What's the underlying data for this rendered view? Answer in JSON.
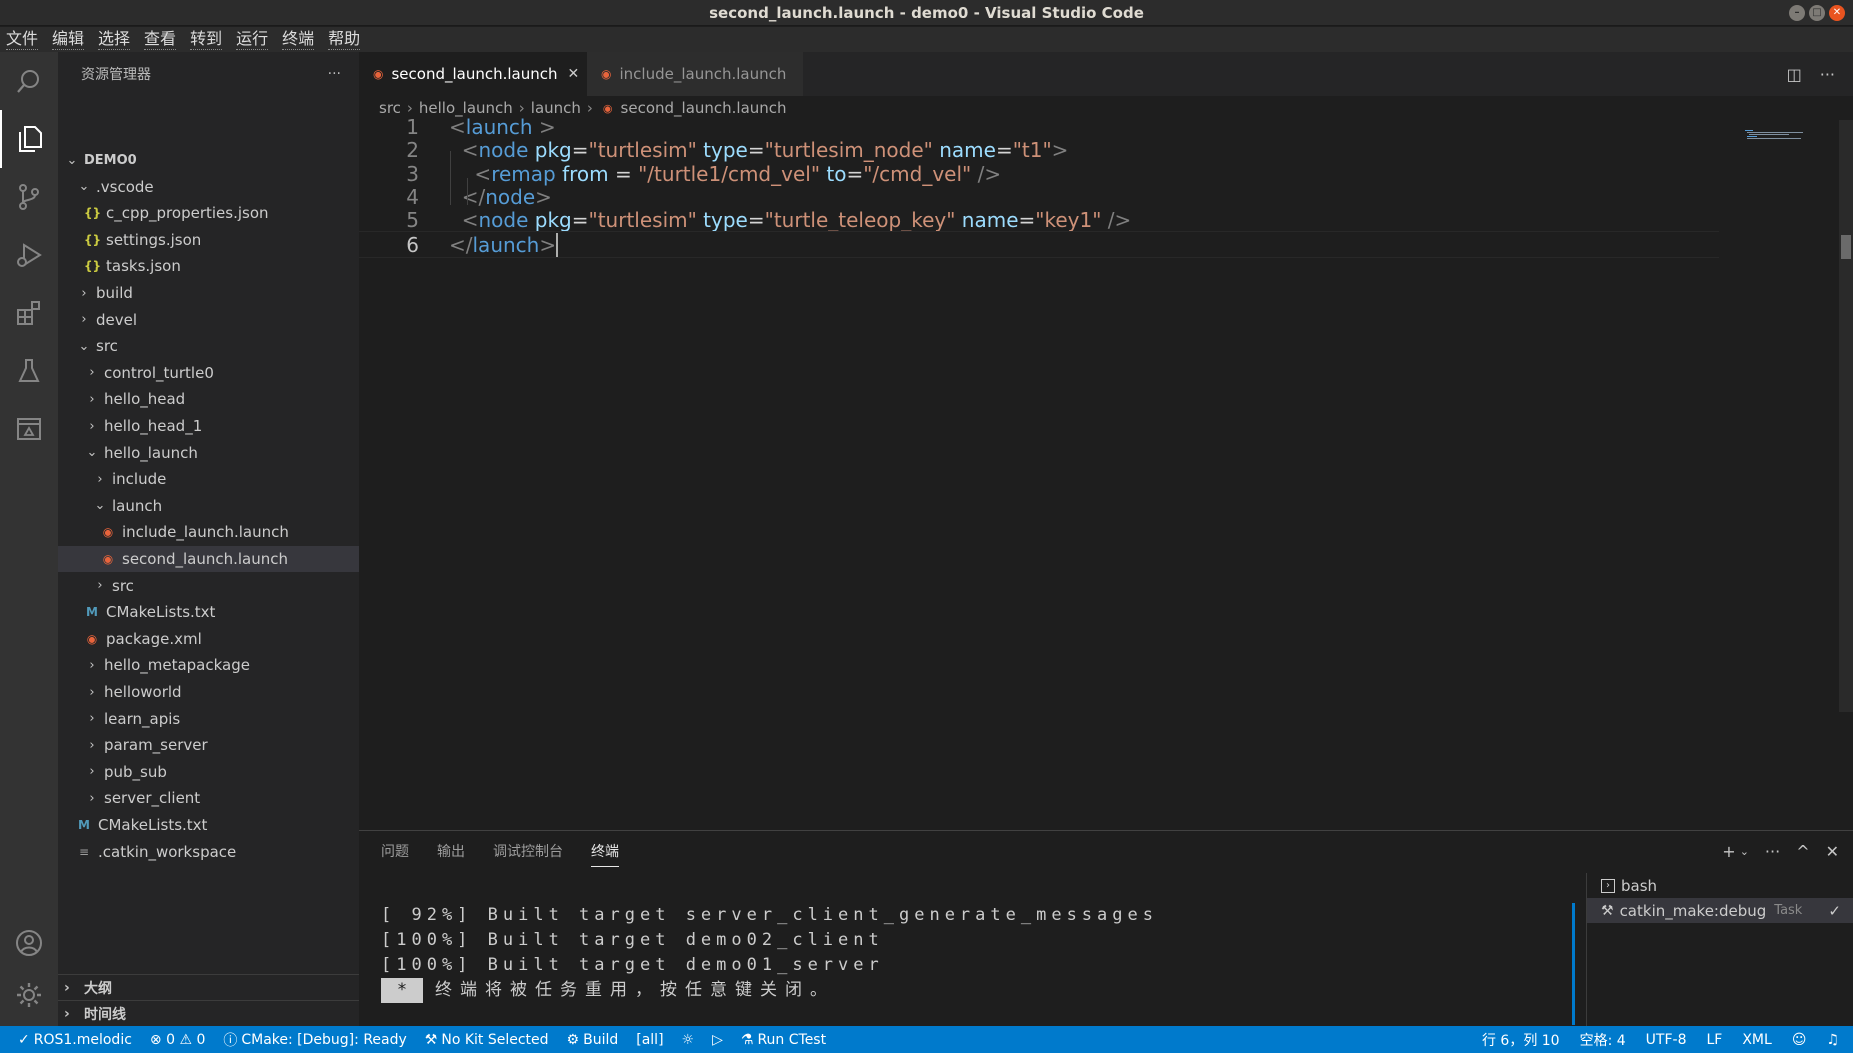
{
  "window": {
    "title": "second_launch.launch - demo0 - Visual Studio Code",
    "min": "–",
    "max": "□",
    "close": "✕"
  },
  "menu": [
    "文件",
    "编辑",
    "选择",
    "查看",
    "转到",
    "运行",
    "终端",
    "帮助"
  ],
  "sidebar": {
    "title": "资源管理器",
    "more": "···",
    "tree": [
      {
        "label": "DEMO0",
        "chev": "⌄",
        "icon": ""
      },
      {
        "label": ".vscode",
        "chev": "⌄",
        "icon": ""
      },
      {
        "label": "c_cpp_properties.json",
        "chev": "",
        "icon": "{}"
      },
      {
        "label": "settings.json",
        "chev": "",
        "icon": "{}"
      },
      {
        "label": "tasks.json",
        "chev": "",
        "icon": "{}"
      },
      {
        "label": "build",
        "chev": "›",
        "icon": ""
      },
      {
        "label": "devel",
        "chev": "›",
        "icon": ""
      },
      {
        "label": "src",
        "chev": "⌄",
        "icon": ""
      },
      {
        "label": "control_turtle0",
        "chev": "›",
        "icon": ""
      },
      {
        "label": "hello_head",
        "chev": "›",
        "icon": ""
      },
      {
        "label": "hello_head_1",
        "chev": "›",
        "icon": ""
      },
      {
        "label": "hello_launch",
        "chev": "⌄",
        "icon": ""
      },
      {
        "label": "include",
        "chev": "›",
        "icon": ""
      },
      {
        "label": "launch",
        "chev": "⌄",
        "icon": ""
      },
      {
        "label": "include_launch.launch",
        "chev": "",
        "icon": "rss"
      },
      {
        "label": "second_launch.launch",
        "chev": "",
        "icon": "rss"
      },
      {
        "label": "src",
        "chev": "›",
        "icon": ""
      },
      {
        "label": "CMakeLists.txt",
        "chev": "",
        "icon": "M"
      },
      {
        "label": "package.xml",
        "chev": "",
        "icon": "rss"
      },
      {
        "label": "hello_metapackage",
        "chev": "›",
        "icon": ""
      },
      {
        "label": "helloworld",
        "chev": "›",
        "icon": ""
      },
      {
        "label": "learn_apis",
        "chev": "›",
        "icon": ""
      },
      {
        "label": "param_server",
        "chev": "›",
        "icon": ""
      },
      {
        "label": "pub_sub",
        "chev": "›",
        "icon": ""
      },
      {
        "label": "server_client",
        "chev": "›",
        "icon": ""
      },
      {
        "label": "CMakeLists.txt",
        "chev": "",
        "icon": "M"
      },
      {
        "label": ".catkin_workspace",
        "chev": "",
        "icon": "≡"
      }
    ],
    "outline": "大纲",
    "timeline": "时间线",
    "collapsed": "›"
  },
  "tabs": [
    {
      "label": "second_launch.launch",
      "close": "✕"
    },
    {
      "label": "include_launch.launch"
    }
  ],
  "breadcrumb": [
    "src",
    "hello_launch",
    "launch",
    "second_launch.launch"
  ],
  "editor": {
    "lines": [
      {
        "n": "1",
        "parts": [
          [
            "t-br",
            "<"
          ],
          [
            "t-tag",
            "launch"
          ],
          [
            "t-br",
            " >"
          ]
        ]
      },
      {
        "n": "2",
        "parts": [
          [
            "t-br",
            "  <"
          ],
          [
            "t-tag",
            "node"
          ],
          [
            "t-attr",
            " pkg"
          ],
          [
            "t-eq",
            "="
          ],
          [
            "t-str",
            "\"turtlesim\""
          ],
          [
            "t-attr",
            " type"
          ],
          [
            "t-eq",
            "="
          ],
          [
            "t-str",
            "\"turtlesim_node\""
          ],
          [
            "t-attr",
            " name"
          ],
          [
            "t-eq",
            "="
          ],
          [
            "t-str",
            "\"t1\""
          ],
          [
            "t-br",
            ">"
          ]
        ]
      },
      {
        "n": "3",
        "parts": [
          [
            "t-br",
            "    <"
          ],
          [
            "t-tag",
            "remap"
          ],
          [
            "t-attr",
            " from"
          ],
          [
            "t-eq",
            " = "
          ],
          [
            "t-str",
            "\"/turtle1/cmd_vel\""
          ],
          [
            "t-attr",
            " to"
          ],
          [
            "t-eq",
            "="
          ],
          [
            "t-str",
            "\"/cmd_vel\""
          ],
          [
            "t-br",
            " />"
          ]
        ]
      },
      {
        "n": "4",
        "parts": [
          [
            "t-br",
            "  </"
          ],
          [
            "t-tag",
            "node"
          ],
          [
            "t-br",
            ">"
          ]
        ]
      },
      {
        "n": "5",
        "parts": [
          [
            "t-br",
            "  <"
          ],
          [
            "t-tag",
            "node"
          ],
          [
            "t-attr",
            " pkg"
          ],
          [
            "t-eq",
            "="
          ],
          [
            "t-str",
            "\"turtlesim\""
          ],
          [
            "t-attr",
            " type"
          ],
          [
            "t-eq",
            "="
          ],
          [
            "t-str",
            "\"turtle_teleop_key\""
          ],
          [
            "t-attr",
            " name"
          ],
          [
            "t-eq",
            "="
          ],
          [
            "t-str",
            "\"key1\""
          ],
          [
            "t-br",
            " />"
          ]
        ]
      },
      {
        "n": "6",
        "parts": [
          [
            "t-br",
            "</"
          ],
          [
            "t-tag",
            "launch"
          ],
          [
            "t-br",
            ">"
          ]
        ]
      }
    ]
  },
  "panel": {
    "tabs": [
      "问题",
      "输出",
      "调试控制台",
      "终端"
    ],
    "terminal_lines": [
      "[ 92%] Built target server_client_generate_messages",
      "[100%] Built target demo02_client",
      "[100%] Built target demo01_server"
    ],
    "cursor_char": "*",
    "reuse_msg": "终端将被任务重用，按任意键关闭。",
    "terminals": [
      {
        "name": "bash",
        "tag": "",
        "check": ""
      },
      {
        "name": "catkin_make:debug",
        "tag": "Task",
        "check": "✓"
      }
    ],
    "add": "+",
    "more": "···",
    "maximize": "^",
    "close": "✕"
  },
  "status": {
    "ros": "ROS1.melodic",
    "problems": "⊗ 0 ⚠ 0",
    "cmake": "CMake: [Debug]: Ready",
    "kit": "No Kit Selected",
    "build": "Build",
    "target": "[all]",
    "ctest": "Run CTest",
    "position": "行 6，列 10",
    "spaces": "空格: 4",
    "encoding": "UTF-8",
    "eol": "LF",
    "language": "XML"
  }
}
